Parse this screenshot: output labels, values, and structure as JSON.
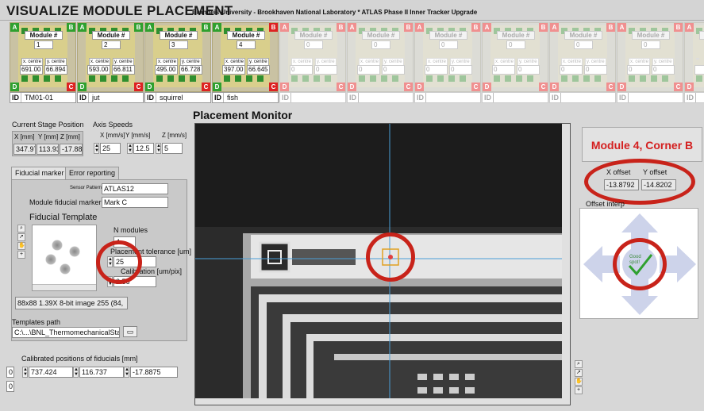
{
  "app": {
    "title": "VISUALIZE MODULE PLACEMENT",
    "subtitle": "Brandeis University - Brookhaven National Laboratory * ATLAS Phase II Inner Tracker Upgrade"
  },
  "modules": [
    {
      "label": "Module #",
      "num": "1",
      "xlabel": "x. centre",
      "ylabel": "y. centre",
      "x": "691.00",
      "y": "66.894",
      "id": "TM01-01",
      "active": true,
      "cornerB_red": false
    },
    {
      "label": "Module #",
      "num": "2",
      "xlabel": "x. centre",
      "ylabel": "y. centre",
      "x": "593.00",
      "y": "66.811",
      "id": "jut",
      "active": true,
      "cornerB_red": false
    },
    {
      "label": "Module #",
      "num": "3",
      "xlabel": "x. centre",
      "ylabel": "y. centre",
      "x": "495.00",
      "y": "66.728",
      "id": "squirrel",
      "active": true,
      "cornerB_red": false
    },
    {
      "label": "Module #",
      "num": "4",
      "xlabel": "x. centre",
      "ylabel": "y. centre",
      "x": "397.00",
      "y": "66.645",
      "id": "fish",
      "active": true,
      "cornerB_red": true
    },
    {
      "label": "Module #",
      "num": "0",
      "xlabel": "x. centre",
      "ylabel": "y. centre",
      "x": "0",
      "y": "0",
      "id": "",
      "active": false
    },
    {
      "label": "Module #",
      "num": "0",
      "xlabel": "x. centre",
      "ylabel": "y. centre",
      "x": "0",
      "y": "0",
      "id": "",
      "active": false
    },
    {
      "label": "Module #",
      "num": "0",
      "xlabel": "x. centre",
      "ylabel": "y. centre",
      "x": "0",
      "y": "0",
      "id": "",
      "active": false
    },
    {
      "label": "Module #",
      "num": "0",
      "xlabel": "x. centre",
      "ylabel": "y. centre",
      "x": "0",
      "y": "0",
      "id": "",
      "active": false
    },
    {
      "label": "Module #",
      "num": "0",
      "xlabel": "x. centre",
      "ylabel": "y. centre",
      "x": "0",
      "y": "0",
      "id": "",
      "active": false
    },
    {
      "label": "Module #",
      "num": "0",
      "xlabel": "x. centre",
      "ylabel": "y. centre",
      "x": "0",
      "y": "0",
      "id": "",
      "active": false
    },
    {
      "label": "M",
      "num": "",
      "xlabel": "",
      "ylabel": "",
      "x": "",
      "y": "",
      "id": "",
      "active": false
    }
  ],
  "corners": {
    "a": "A",
    "b": "B",
    "c": "C",
    "d": "D",
    "id": "ID"
  },
  "stage": {
    "title": "Current Stage Position",
    "x_label": "X [mm]",
    "y_label": "Y [mm]",
    "z_label": "Z [mm]",
    "x": "347.97",
    "y": "113.93",
    "z": "-17.88"
  },
  "speeds": {
    "title": "Axis Speeds",
    "x_label": "X [mm/s]",
    "y_label": "Y [mm/s]",
    "z_label": "Z [mm/s]",
    "x": "25",
    "y": "12.5",
    "z": "5"
  },
  "tabs": {
    "fiducial": "Fiducial marker",
    "errors": "Error reporting"
  },
  "fiducial": {
    "pattern_label": "Sensor Pattern",
    "pattern": "ATLAS12",
    "marker_label": "Module fiducial marker",
    "marker": "Mark C",
    "template_title": "Fiducial Template",
    "nmodules_label": "N modules",
    "nmodules": "4",
    "tolerance_label": "Placement tolerance [um]",
    "tolerance": "25",
    "calibration_label": "Calibration [um/pix]",
    "calibration": "2.56",
    "image_info": "88x88 1.39X 8-bit image 255    (84,",
    "templates_label": "Templates path",
    "templates_path": "C:\\...\\BNL_ThermomechanicalStave"
  },
  "calibrated": {
    "title": "Calibrated positions of fiducials [mm]",
    "index": "0",
    "index2": "0",
    "x": "737.424",
    "y": "116.737",
    "z": "-17.8875"
  },
  "monitor": {
    "title": "Placement Monitor"
  },
  "result": {
    "banner": "Module 4,  Corner B",
    "xoffset_label": "X offset",
    "yoffset_label": "Y offset",
    "xoffset": "-13.8792",
    "yoffset": "-14.8202",
    "interp_label": "Offset interp",
    "good_text": "Good spot!"
  },
  "colors": {
    "ring": "#c8231a",
    "green": "#2fa02f",
    "red": "#d22",
    "crosshair": "#4a9fd8",
    "banner_text": "#d42020"
  },
  "icons": [
    "magnifier-icon",
    "arrow-icon",
    "hand-icon",
    "crosshair-icon",
    "folder-icon",
    "check-icon"
  ]
}
